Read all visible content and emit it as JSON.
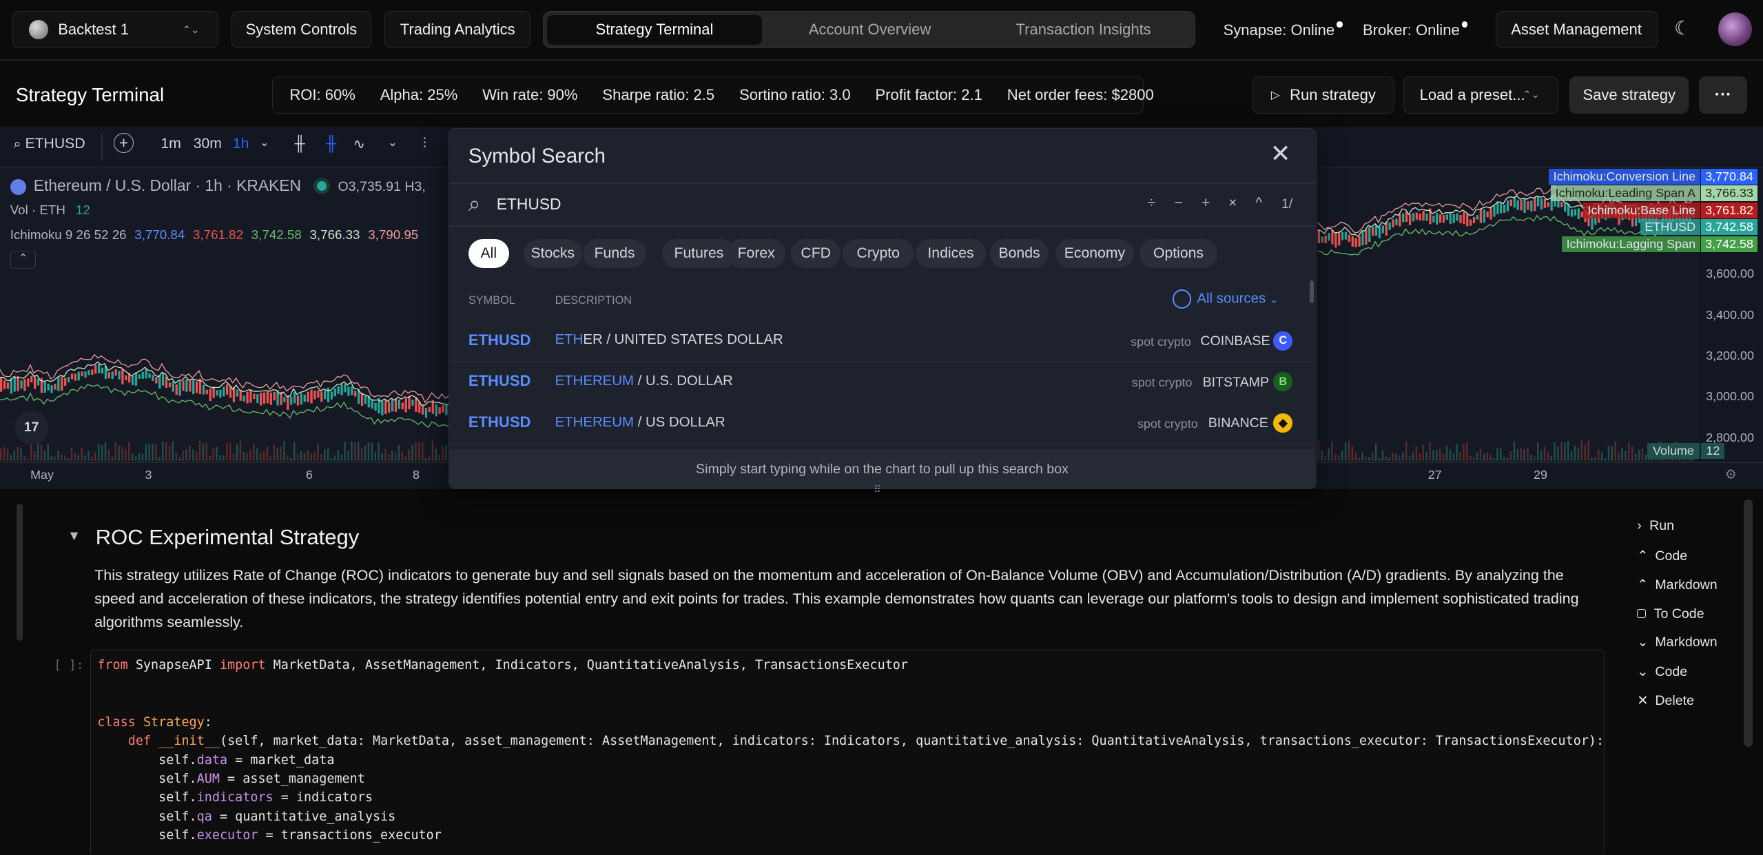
{
  "topbar": {
    "backtest": "Backtest 1",
    "system_controls": "System Controls",
    "trading_analytics": "Trading Analytics",
    "tabs": [
      "Strategy Terminal",
      "Account Overview",
      "Transaction Insights"
    ],
    "synapse": "Synapse: Online",
    "broker": "Broker: Online",
    "asset_management": "Asset Management"
  },
  "header": {
    "title": "Strategy Terminal",
    "stats": [
      "ROI: 60%",
      "Alpha: 25%",
      "Win rate: 90%",
      "Sharpe ratio: 2.5",
      "Sortino ratio: 3.0",
      "Profit factor: 2.1",
      "Net order fees: $2800"
    ],
    "run": "Run strategy",
    "preset": "Load a preset...",
    "save": "Save strategy",
    "more": "···"
  },
  "chart": {
    "symbol": "ETHUSD",
    "intervals": [
      "1m",
      "30m",
      "1h"
    ],
    "title": "Ethereum / U.S. Dollar · 1h · KRAKEN",
    "ohlc": "O3,735.91 H3,",
    "vol": "Vol · ETH",
    "vol_val": "12",
    "ichimoku": "Ichimoku 9 26 52 26",
    "ichimoku_vals": [
      "3,770.84",
      "3,761.82",
      "3,742.58",
      "3,766.33",
      "3,790.95"
    ],
    "right_tags": [
      {
        "name": "Ichimoku:Conversion Line",
        "value": "3,770.84",
        "color": "#2962ff"
      },
      {
        "name": "Ichimoku:Leading Span A",
        "value": "3,766.33",
        "color": "#a5d6a7"
      },
      {
        "name": "Ichimoku:Base Line",
        "value": "3,761.82",
        "color": "#b71c1c"
      },
      {
        "name": "ETHUSD",
        "value": "3,742.58",
        "color": "#26a69a"
      },
      {
        "name": "Ichimoku:Lagging Span",
        "value": "3,742.58",
        "color": "#43a047"
      }
    ],
    "y_ticks": [
      "3,600.00",
      "3,400.00",
      "3,200.00",
      "3,000.00",
      "2,800.00"
    ],
    "x_ticks": [
      "May",
      "3",
      "6",
      "8",
      "27",
      "29"
    ],
    "volume_tag": "Volume",
    "volume_val": "12"
  },
  "search": {
    "title": "Symbol Search",
    "query": "ETHUSD",
    "counter": "1/",
    "filters": [
      "All",
      "Stocks",
      "Funds",
      "Futures",
      "Forex",
      "CFD",
      "Crypto",
      "Indices",
      "Bonds",
      "Economy",
      "Options"
    ],
    "col_symbol": "SYMBOL",
    "col_desc": "DESCRIPTION",
    "sources": "All sources",
    "results": [
      {
        "symbol": "ETHUSD",
        "hl": "ETH",
        "rest": "ER / UNITED STATES DOLLAR",
        "type": "spot crypto",
        "exchange": "COINBASE",
        "logo": "C",
        "logo_color": "#3d5afe"
      },
      {
        "symbol": "ETHUSD",
        "hl": "ETHEREUM",
        "rest": " / U.S. DOLLAR",
        "type": "spot crypto",
        "exchange": "BITSTAMP",
        "logo": "B",
        "logo_color": "#1b5e20"
      },
      {
        "symbol": "ETHUSD",
        "hl": "ETHEREUM",
        "rest": " / US DOLLAR",
        "type": "spot crypto",
        "exchange": "BINANCE",
        "logo": "◆",
        "logo_color": "#f0b90b"
      }
    ],
    "hint": "Simply start typing while on the chart to pull up this search box"
  },
  "notebook": {
    "title": "ROC Experimental Strategy",
    "desc": "This strategy utilizes Rate of Change (ROC) indicators to generate buy and sell signals based on the momentum and acceleration of On-Balance Volume (OBV) and Accumulation/Distribution (A/D) gradients. By analyzing the speed and acceleration of these indicators, the strategy identifies potential entry and exit points for trades. This example demonstrates how quants can leverage our platform's tools to design and implement sophisticated trading algorithms seamlessly.",
    "prompt": "[ ]:",
    "controls": [
      "Run",
      "Code",
      "Markdown",
      "To Code",
      "Markdown",
      "Code",
      "Delete"
    ]
  }
}
